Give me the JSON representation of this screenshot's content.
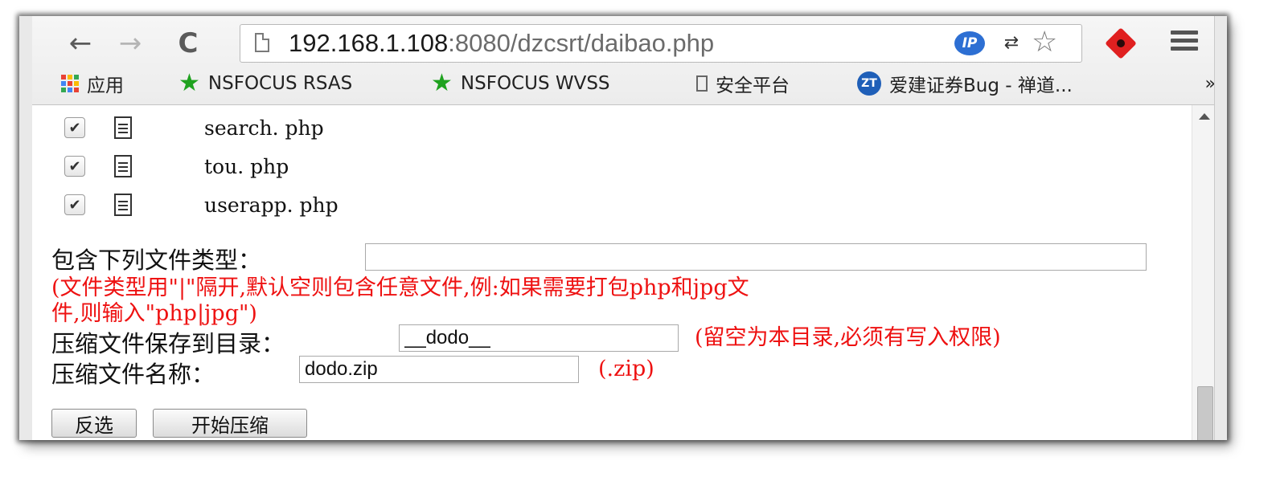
{
  "browser": {
    "url_host": "192.168.1.108",
    "url_rest": ":8080/dzcsrt/daibao.php",
    "extension_ip_label": "IP",
    "bookmarks": [
      {
        "label": "应用",
        "icon": "apps-grid-icon"
      },
      {
        "label": "NSFOCUS RSAS",
        "icon": "green-star-icon"
      },
      {
        "label": "NSFOCUS WVSS",
        "icon": "green-star-icon"
      },
      {
        "label": "安全平台",
        "icon": "page-icon"
      },
      {
        "label": "爱建证券Bug - 禅道...",
        "icon": "zentao-icon"
      }
    ],
    "overflow_label": "»",
    "zentao_icon_text": "ZT"
  },
  "files": [
    {
      "name": "search. php",
      "checked": true
    },
    {
      "name": "tou. php",
      "checked": true
    },
    {
      "name": "userapp. php",
      "checked": true
    }
  ],
  "form": {
    "file_types_label": "包含下列文件类型：",
    "file_types_value": "",
    "file_types_hint_line1": "(文件类型用\"|\"隔开,默认空则包含任意文件,例:如果需要打包php和jpg文",
    "file_types_hint_line2": "件,则输入\"php|jpg\")",
    "save_dir_label": "压缩文件保存到目录：",
    "save_dir_value": "__dodo__",
    "save_dir_hint": "(留空为本目录,必须有写入权限)",
    "zip_name_label": "压缩文件名称：",
    "zip_name_value": "dodo.zip",
    "zip_name_hint": "(.zip)",
    "invert_button": "反选",
    "start_button": "开始压缩"
  },
  "colors": {
    "hint_red": "#ee1111",
    "star_green": "#1fa21f"
  }
}
